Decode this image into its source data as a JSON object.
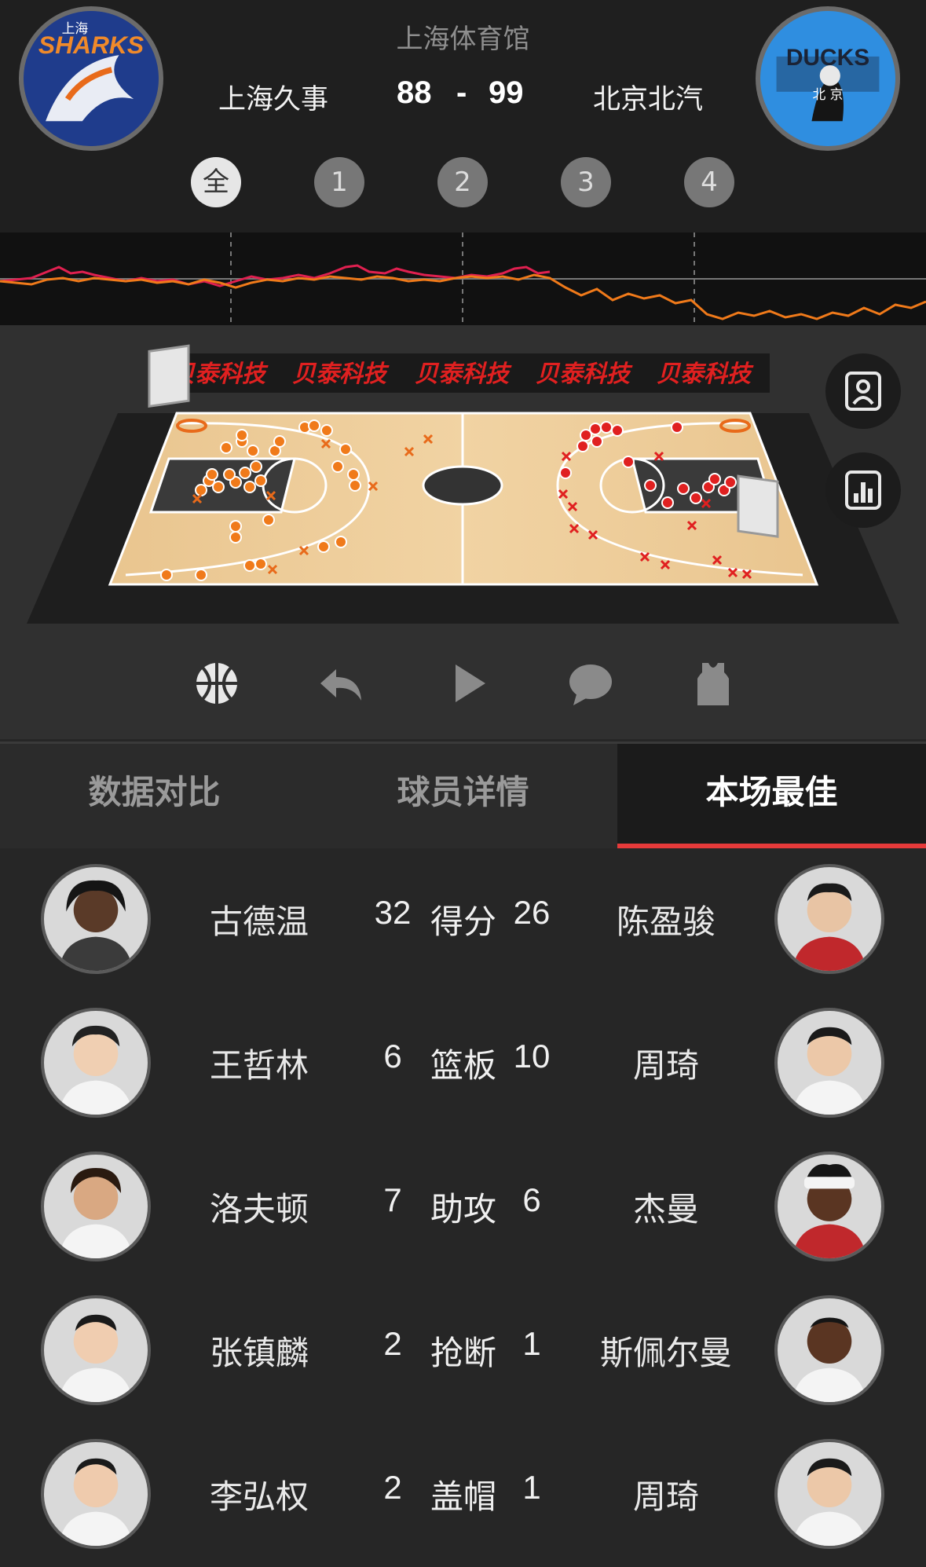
{
  "header": {
    "venue": "上海体育馆",
    "home_team": "上海久事",
    "away_team": "北京北汽",
    "home_score": "88",
    "away_score": "99",
    "score_separator": "-",
    "home_logo_text": "SHARKS",
    "home_logo_cn": "上海",
    "away_logo_text": "DUCKS",
    "away_logo_cn": "北 京"
  },
  "quarters": [
    {
      "label": "全",
      "active": true
    },
    {
      "label": "1",
      "active": false
    },
    {
      "label": "2",
      "active": false
    },
    {
      "label": "3",
      "active": false
    },
    {
      "label": "4",
      "active": false
    }
  ],
  "court": {
    "sponsor_text": "贝泰科技",
    "home_color": "#f07a1a",
    "away_color": "#e02020"
  },
  "toolbar": [
    "basketball-icon",
    "undo-icon",
    "play-icon",
    "comment-icon",
    "jersey-icon"
  ],
  "tabs": [
    {
      "label": "数据对比",
      "active": false
    },
    {
      "label": "球员详情",
      "active": false
    },
    {
      "label": "本场最佳",
      "active": true
    }
  ],
  "best": [
    {
      "stat": "得分",
      "left_name": "古德温",
      "left_value": "32",
      "right_value": "26",
      "right_name": "陈盈骏"
    },
    {
      "stat": "篮板",
      "left_name": "王哲林",
      "left_value": "6",
      "right_value": "10",
      "right_name": "周琦"
    },
    {
      "stat": "助攻",
      "left_name": "洛夫顿",
      "left_value": "7",
      "right_value": "6",
      "right_name": "杰曼"
    },
    {
      "stat": "抢断",
      "left_name": "张镇麟",
      "left_value": "2",
      "right_value": "1",
      "right_name": "斯佩尔曼"
    },
    {
      "stat": "盖帽",
      "left_name": "李弘权",
      "left_value": "2",
      "right_value": "1",
      "right_name": "周琦"
    }
  ],
  "colors": {
    "accent": "#e63a3a",
    "trend_home": "#f07a1a",
    "trend_away": "#e02050"
  }
}
